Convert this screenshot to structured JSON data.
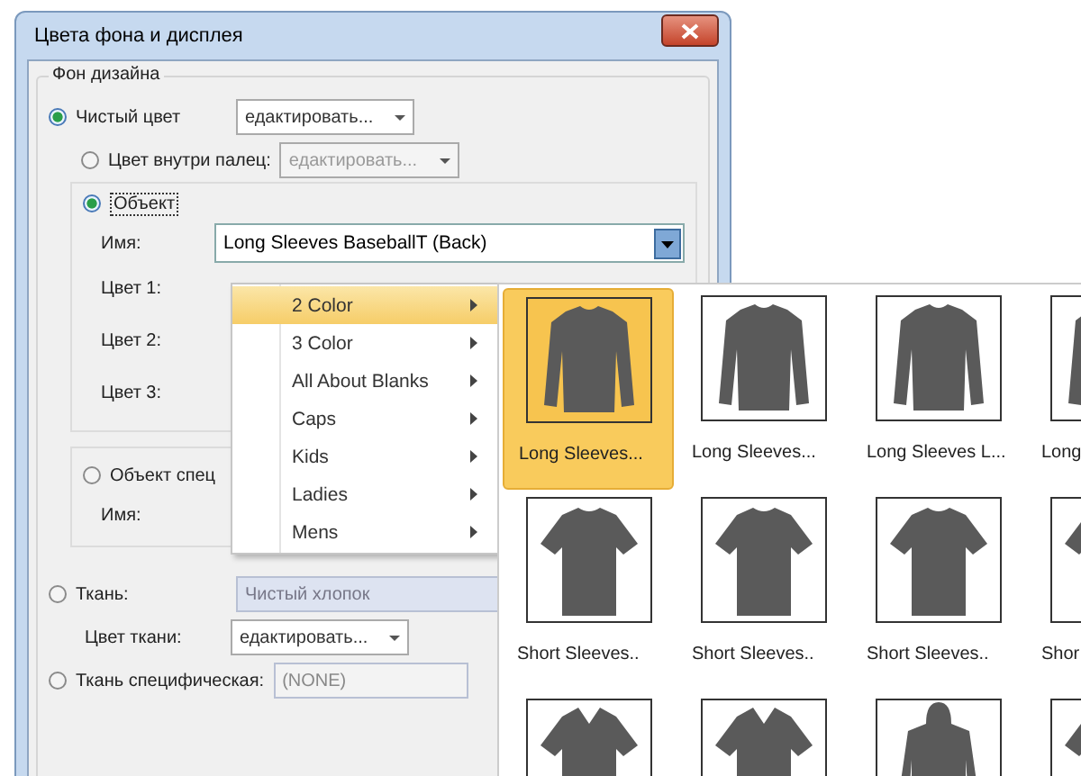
{
  "window": {
    "title": "Цвета фона и дисплея"
  },
  "group": {
    "title": "Фон дизайна"
  },
  "solid": {
    "label": "Чистый цвет",
    "selected": true,
    "dropdown": "едактировать..."
  },
  "inside": {
    "label": "Цвет внутри палец:",
    "selected": false,
    "dropdown": "едактировать..."
  },
  "object": {
    "label": "Объект",
    "selected": true,
    "name_label": "Имя:",
    "name_value": "Long Sleeves BaseballT (Back)",
    "colors": [
      "Цвет 1:",
      "Цвет 2:",
      "Цвет 3:"
    ]
  },
  "object_specific": {
    "label": "Объект спец",
    "selected": false,
    "name_label": "Имя:"
  },
  "fabric": {
    "label": "Ткань:",
    "selected": false,
    "value": "Чистый хлопок",
    "color_label": "Цвет ткани:",
    "color_dropdown": "едактировать..."
  },
  "fabric_specific": {
    "label": "Ткань специфическая:",
    "selected": false,
    "value": "(NONE)"
  },
  "menu": {
    "items": [
      {
        "label": "2 Color",
        "selected": true
      },
      {
        "label": "3 Color",
        "selected": false
      },
      {
        "label": "All About Blanks",
        "selected": false
      },
      {
        "label": "Caps",
        "selected": false
      },
      {
        "label": "Kids",
        "selected": false
      },
      {
        "label": "Ladies",
        "selected": false
      },
      {
        "label": "Mens",
        "selected": false
      }
    ]
  },
  "gallery": {
    "rows": [
      [
        {
          "kind": "long",
          "name": "Long  Sleeves...",
          "selected": true
        },
        {
          "kind": "long",
          "name": "Long  Sleeves...",
          "selected": false
        },
        {
          "kind": "long",
          "name": "Long  Sleeves L...",
          "selected": false
        },
        {
          "kind": "long",
          "name": "Long",
          "selected": false
        }
      ],
      [
        {
          "kind": "short",
          "name": "Short  Sleeves..",
          "selected": false
        },
        {
          "kind": "short",
          "name": "Short  Sleeves..",
          "selected": false
        },
        {
          "kind": "short",
          "name": "Short  Sleeves..",
          "selected": false
        },
        {
          "kind": "short",
          "name": "Shor",
          "selected": false
        }
      ],
      [
        {
          "kind": "polo",
          "selected": false
        },
        {
          "kind": "polo",
          "selected": false
        },
        {
          "kind": "hoodie",
          "selected": false
        },
        {
          "kind": "short",
          "selected": false
        }
      ]
    ]
  }
}
